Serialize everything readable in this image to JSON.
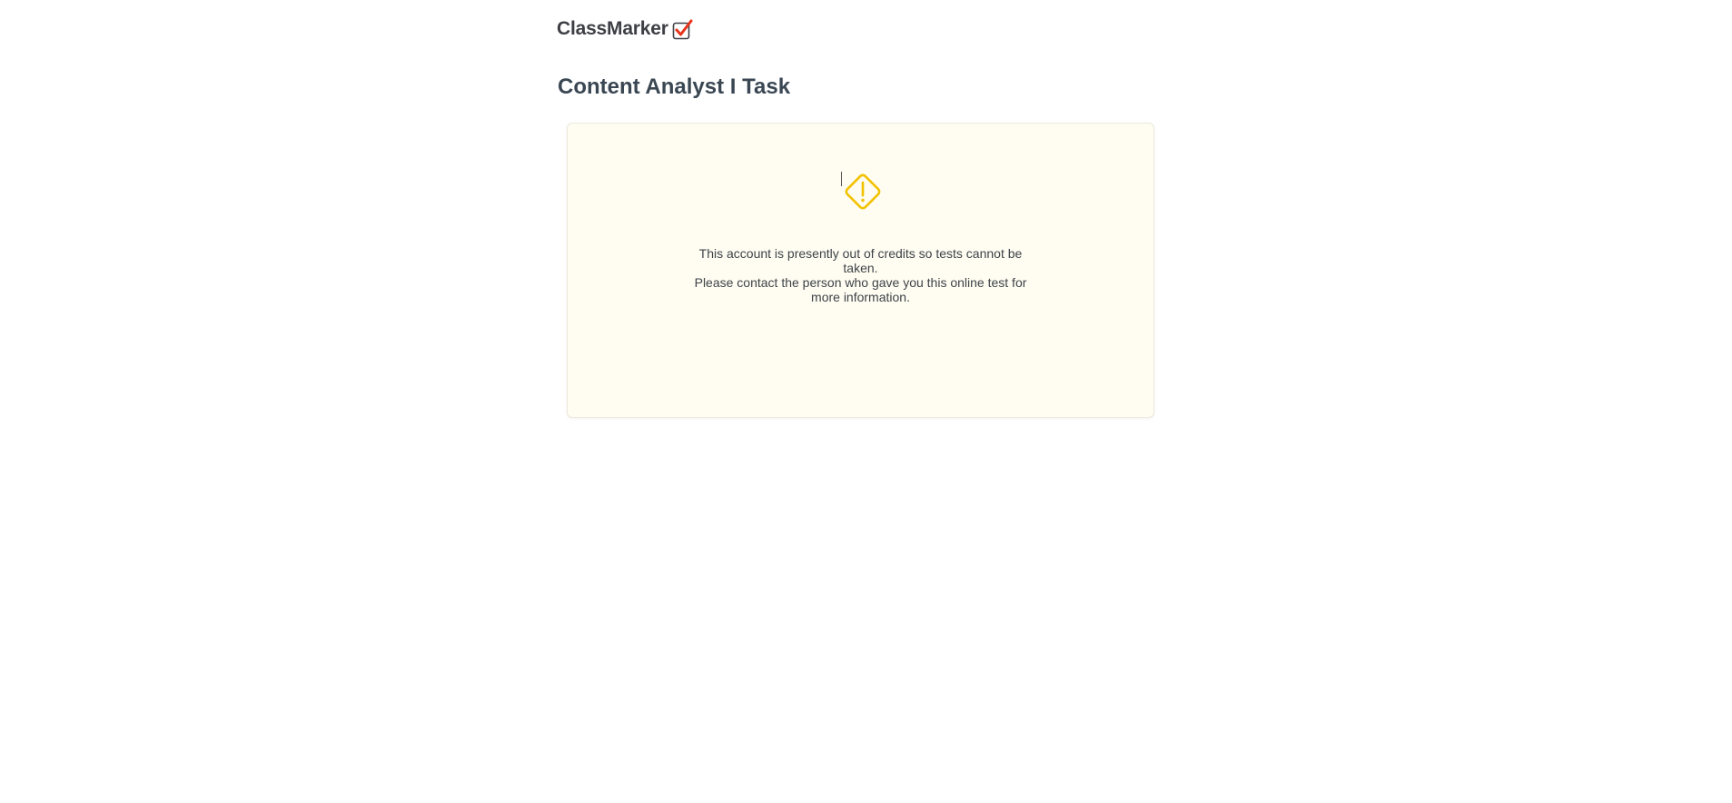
{
  "brand": {
    "name": "ClassMarker",
    "logo_icon": "checkbox-check-icon",
    "accent_color": "#e8341c"
  },
  "page": {
    "title": "Content Analyst I Task"
  },
  "notice": {
    "icon": "warning-diamond-icon",
    "icon_color": "#f2c200",
    "line1": "This account is presently out of credits so tests cannot be taken.",
    "line2": "Please contact the person who gave you this online test for more information."
  }
}
